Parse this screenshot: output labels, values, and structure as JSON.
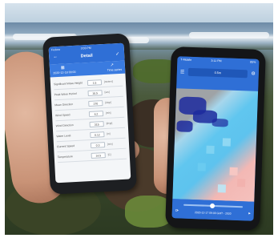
{
  "left_phone": {
    "status_carrier": "Fedora",
    "status_time": "3:03 PM",
    "title": "Detail",
    "sub_left": "2020-12-18 00:00",
    "sub_right": "Time series",
    "rows": [
      {
        "label": "Significant Wave Height",
        "value": "1.5",
        "unit": "[meters]"
      },
      {
        "label": "Peak Wave Period",
        "value": "10.5",
        "unit": "[sec]"
      },
      {
        "label": "Mean Direction",
        "value": "270",
        "unit": "[degr]"
      },
      {
        "label": "Wind Speed",
        "value": "6.2",
        "unit": "[m/s]"
      },
      {
        "label": "Wind Direction",
        "value": "315",
        "unit": "[degr]"
      },
      {
        "label": "Water Level",
        "value": "0.12",
        "unit": "[m]"
      },
      {
        "label": "Current Speed",
        "value": "0.3",
        "unit": "[m/s]"
      },
      {
        "label": "Temperature",
        "value": "14.5",
        "unit": "[C]"
      }
    ]
  },
  "right_phone": {
    "status_carrier": "T-Mobile",
    "status_time": "3:11 PM",
    "status_battery": "85%",
    "search_label": "0.5m",
    "time_label": "2020-12-17 09:00 GMT - 2020"
  },
  "colors": {
    "app_blue": "#2f6fd6",
    "land_gray": "#9fa3a6",
    "water_cyan": "#5ec3ee",
    "water_pink": "#f3b8b4",
    "coast_navy": "#1c2a9e"
  }
}
